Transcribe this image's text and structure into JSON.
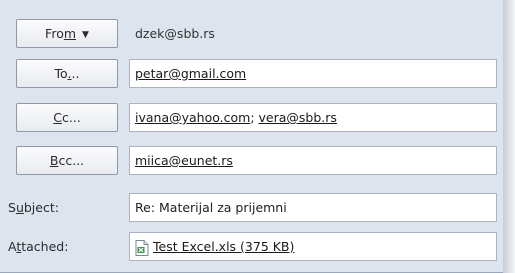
{
  "from": {
    "button_label_pre": "Fro",
    "button_label_acc": "m",
    "button_arrow": "▼",
    "value": "dzek@sbb.rs"
  },
  "to": {
    "button_label_pre": "To",
    "button_label_acc": ".",
    "button_label_post": "..",
    "recipients": [
      "petar@gmail.com"
    ]
  },
  "cc": {
    "button_label_acc": "C",
    "button_label_post": "c...",
    "recipients": [
      "ivana@yahoo.com",
      "vera@sbb.rs"
    ],
    "separator": "; "
  },
  "bcc": {
    "button_label_acc": "B",
    "button_label_post": "cc...",
    "recipients": [
      "miica@eunet.rs"
    ]
  },
  "subject": {
    "label_pre": "S",
    "label_acc": "u",
    "label_post": "bject:",
    "value": "Re: Materijal za prijemni"
  },
  "attached": {
    "label_pre": "A",
    "label_acc": "t",
    "label_post": "tached:",
    "file": "Test Excel.xls (375 KB)",
    "icon": "excel-file-icon"
  },
  "colors": {
    "panel": "#dde4ee",
    "field_border": "#aab4c4",
    "button_border": "#8f9aa9"
  }
}
